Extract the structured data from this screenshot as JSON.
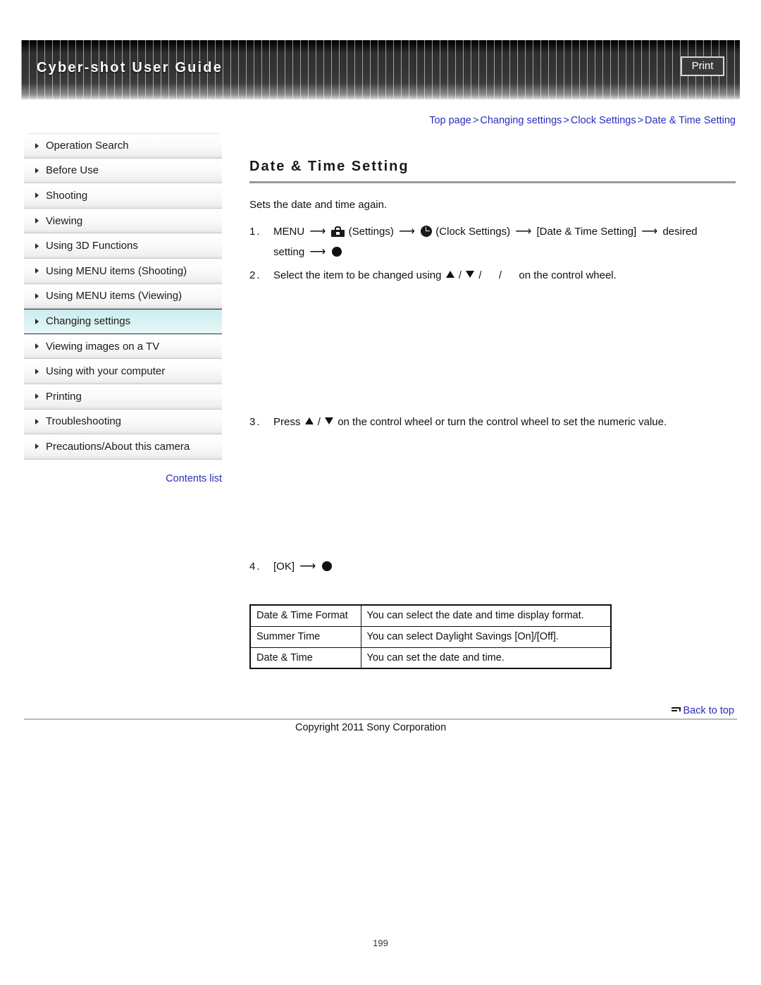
{
  "header": {
    "title": "Cyber-shot User Guide",
    "print_label": "Print"
  },
  "breadcrumb": {
    "items": [
      "Top page",
      "Changing settings",
      "Clock Settings",
      "Date & Time Setting"
    ],
    "separator": ">"
  },
  "sidebar": {
    "items": [
      {
        "label": "Operation Search",
        "active": false
      },
      {
        "label": "Before Use",
        "active": false
      },
      {
        "label": "Shooting",
        "active": false
      },
      {
        "label": "Viewing",
        "active": false
      },
      {
        "label": "Using 3D Functions",
        "active": false
      },
      {
        "label": "Using MENU items (Shooting)",
        "active": false
      },
      {
        "label": "Using MENU items (Viewing)",
        "active": false
      },
      {
        "label": "Changing settings",
        "active": true
      },
      {
        "label": "Viewing images on a TV",
        "active": false
      },
      {
        "label": "Using with your computer",
        "active": false
      },
      {
        "label": "Printing",
        "active": false
      },
      {
        "label": "Troubleshooting",
        "active": false
      },
      {
        "label": "Precautions/About this camera",
        "active": false
      }
    ],
    "contents_list_label": "Contents list"
  },
  "main": {
    "title": "Date & Time Setting",
    "intro": "Sets the date and time again.",
    "steps": {
      "s1_num": "1.",
      "s1_a": "MENU",
      "s1_settings": "(Settings)",
      "s1_clock": "(Clock Settings)",
      "s1_bracket": "[Date & Time Setting]",
      "s1_desired": "desired",
      "s1_setting": "setting",
      "s2_num": "2.",
      "s2_a": "Select the item to be changed using",
      "s2_b": "on the control wheel.",
      "s3_num": "3.",
      "s3_a": "Press",
      "s3_b": "on the control wheel or turn the control wheel to set the numeric value.",
      "s4_num": "4.",
      "s4_a": "[OK]"
    }
  },
  "table": {
    "rows": [
      {
        "key": "Date & Time Format",
        "value": "You can select the date and time display format."
      },
      {
        "key": "Summer Time",
        "value": "You can select Daylight Savings [On]/[Off]."
      },
      {
        "key": "Date & Time",
        "value": "You can set the date and time."
      }
    ]
  },
  "footer": {
    "back_to_top": "Back to top",
    "copyright": "Copyright 2011 Sony Corporation",
    "page_number": "199"
  },
  "colors": {
    "link": "#2b2bbb",
    "active_nav": "#d7f1f2",
    "header_bg": "#2b2b2b"
  }
}
